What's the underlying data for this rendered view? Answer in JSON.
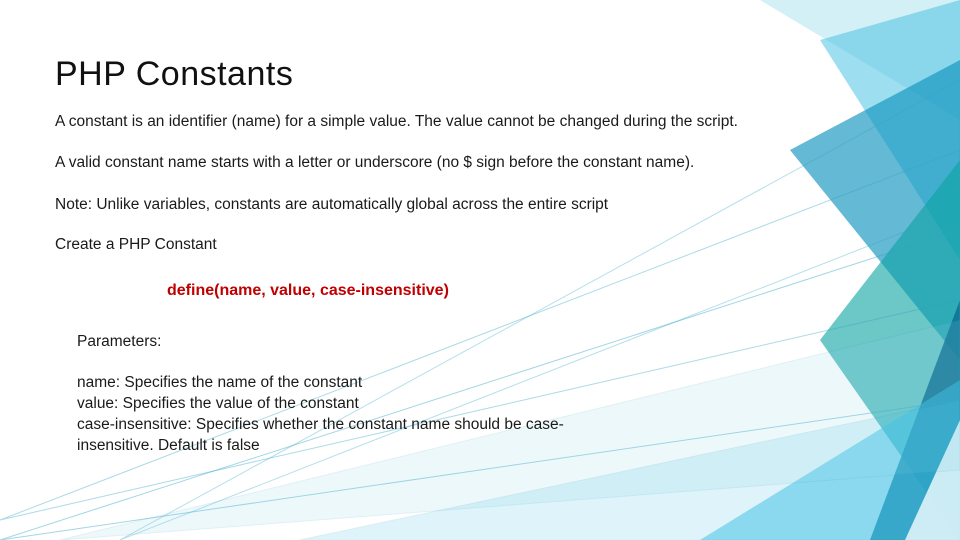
{
  "title": "PHP Constants",
  "para1": "A constant is an identifier (name) for a simple value. The value cannot be changed during the script.",
  "para2": "A valid constant name starts with a letter or underscore (no $ sign before the constant name).",
  "para3": "Note: Unlike variables, constants are automatically global across the entire script",
  "subhead": "Create a PHP Constant",
  "syntax": "define(name, value, case-insensitive)",
  "params_heading": "Parameters:",
  "param_lines": [
    "name: Specifies the name of the constant",
    "value: Specifies the value of the constant",
    "case-insensitive: Specifies whether the constant name should be case-insensitive. Default is false"
  ],
  "colors": {
    "syntax": "#c00000",
    "accent_stroke": "#2fa3c4",
    "tri_light": "#8fd4e8",
    "tri_mid": "#2aa9cf",
    "tri_dark": "#0e6f93",
    "tri_teal": "#0aa2a2"
  }
}
